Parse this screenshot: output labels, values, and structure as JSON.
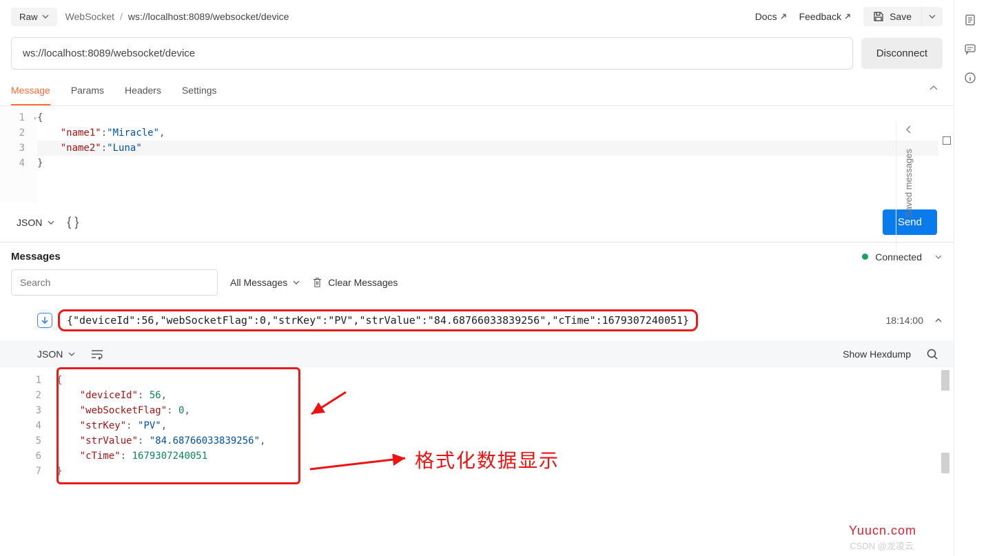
{
  "topbar": {
    "raw_label": "Raw",
    "protocol": "WebSocket",
    "url": "ws://localhost:8089/websocket/device",
    "docs_label": "Docs",
    "feedback_label": "Feedback",
    "save_label": "Save"
  },
  "url_row": {
    "url_value": "ws://localhost:8089/websocket/device",
    "disconnect_label": "Disconnect"
  },
  "tabs": {
    "items": [
      "Message",
      "Params",
      "Headers",
      "Settings"
    ],
    "active_index": 0
  },
  "editor": {
    "lines": [
      {
        "n": "1",
        "tokens": [
          {
            "t": "punc",
            "v": "{"
          }
        ]
      },
      {
        "n": "2",
        "tokens": [
          {
            "t": "indent",
            "v": "    "
          },
          {
            "t": "key",
            "v": "\"name1\""
          },
          {
            "t": "punc",
            "v": ":"
          },
          {
            "t": "str",
            "v": "\"Miracle\""
          },
          {
            "t": "punc",
            "v": ","
          }
        ]
      },
      {
        "n": "3",
        "tokens": [
          {
            "t": "indent",
            "v": "    "
          },
          {
            "t": "key",
            "v": "\"name2\""
          },
          {
            "t": "punc",
            "v": ":"
          },
          {
            "t": "str",
            "v": "\"Luna\""
          }
        ]
      },
      {
        "n": "4",
        "tokens": [
          {
            "t": "punc",
            "v": "}"
          }
        ]
      }
    ]
  },
  "editor_footer": {
    "format_label": "JSON",
    "send_label": "Send"
  },
  "messages": {
    "title": "Messages",
    "status_label": "Connected",
    "search_placeholder": "Search",
    "filter_label": "All Messages",
    "clear_label": "Clear Messages"
  },
  "message_row": {
    "direction": "down",
    "raw_text": "{\"deviceId\":56,\"webSocketFlag\":0,\"strKey\":\"PV\",\"strValue\":\"84.68766033839256\",\"cTime\":1679307240051}",
    "time": "18:14:00"
  },
  "viewer_bar": {
    "format_label": "JSON",
    "hexdump_label": "Show Hexdump"
  },
  "json_view": {
    "lines": [
      {
        "n": "1",
        "tokens": [
          {
            "t": "punc",
            "v": "{"
          }
        ]
      },
      {
        "n": "2",
        "tokens": [
          {
            "t": "indent",
            "v": "    "
          },
          {
            "t": "key",
            "v": "\"deviceId\""
          },
          {
            "t": "punc",
            "v": ": "
          },
          {
            "t": "num",
            "v": "56"
          },
          {
            "t": "punc",
            "v": ","
          }
        ]
      },
      {
        "n": "3",
        "tokens": [
          {
            "t": "indent",
            "v": "    "
          },
          {
            "t": "key",
            "v": "\"webSocketFlag\""
          },
          {
            "t": "punc",
            "v": ": "
          },
          {
            "t": "num",
            "v": "0"
          },
          {
            "t": "punc",
            "v": ","
          }
        ]
      },
      {
        "n": "4",
        "tokens": [
          {
            "t": "indent",
            "v": "    "
          },
          {
            "t": "key",
            "v": "\"strKey\""
          },
          {
            "t": "punc",
            "v": ": "
          },
          {
            "t": "str",
            "v": "\"PV\""
          },
          {
            "t": "punc",
            "v": ","
          }
        ]
      },
      {
        "n": "5",
        "tokens": [
          {
            "t": "indent",
            "v": "    "
          },
          {
            "t": "key",
            "v": "\"strValue\""
          },
          {
            "t": "punc",
            "v": ": "
          },
          {
            "t": "str",
            "v": "\"84.68766033839256\""
          },
          {
            "t": "punc",
            "v": ","
          }
        ]
      },
      {
        "n": "6",
        "tokens": [
          {
            "t": "indent",
            "v": "    "
          },
          {
            "t": "key",
            "v": "\"cTime\""
          },
          {
            "t": "punc",
            "v": ": "
          },
          {
            "t": "num",
            "v": "1679307240051"
          }
        ]
      },
      {
        "n": "7",
        "tokens": [
          {
            "t": "punc",
            "v": "}"
          }
        ]
      }
    ]
  },
  "annotation": {
    "label": "格式化数据显示"
  },
  "saved_rail": {
    "label": "Saved messages"
  },
  "watermark": "Yuucn.com",
  "credit": "CSDN @龙凌云"
}
